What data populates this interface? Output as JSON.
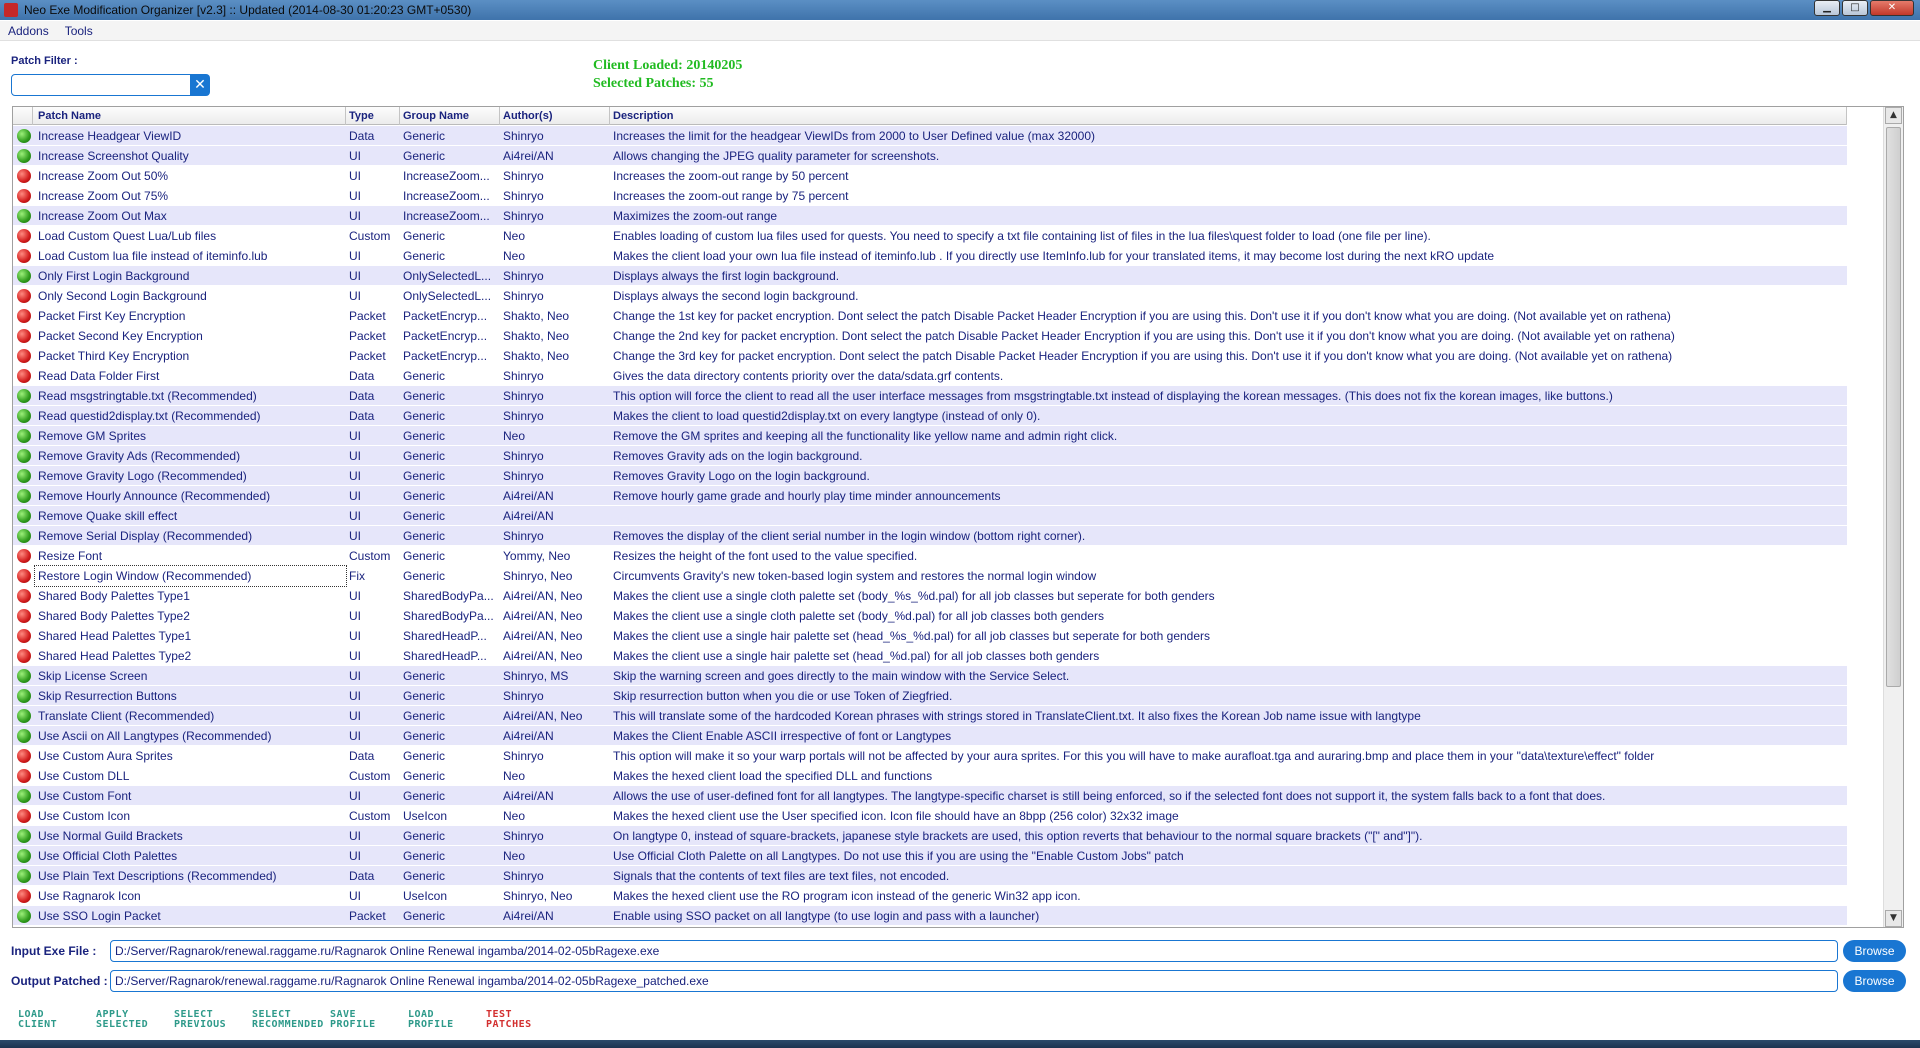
{
  "window": {
    "title": "Neo Exe Modification Organizer [v2.3]    ::   Updated (2014-08-30  01:20:23  GMT+0530)",
    "min": "▁",
    "max": "□",
    "close": "✕"
  },
  "menu": [
    "Addons",
    "Tools"
  ],
  "filter": {
    "label": "Patch Filter :",
    "value": "",
    "clear": "✕"
  },
  "client": {
    "loaded": "Client Loaded: 20140205",
    "selected": "Selected Patches: 55"
  },
  "table": {
    "columns": [
      "Patch Name",
      "Type",
      "Group Name",
      "Author(s)",
      "Description"
    ],
    "rows": [
      {
        "on": true,
        "sel": true,
        "name": "Increase Headgear ViewID",
        "type": "Data",
        "group": "Generic",
        "author": "Shinryo",
        "desc": "Increases the limit for the headgear ViewIDs from 2000 to User Defined value (max 32000)"
      },
      {
        "on": true,
        "sel": true,
        "name": "Increase Screenshot Quality",
        "type": "UI",
        "group": "Generic",
        "author": "Ai4rei/AN",
        "desc": "Allows changing the JPEG quality parameter for screenshots."
      },
      {
        "on": false,
        "sel": false,
        "name": "Increase Zoom Out 50%",
        "type": "UI",
        "group": "IncreaseZoom...",
        "author": "Shinryo",
        "desc": "Increases the zoom-out range by 50 percent"
      },
      {
        "on": false,
        "sel": false,
        "name": "Increase Zoom Out 75%",
        "type": "UI",
        "group": "IncreaseZoom...",
        "author": "Shinryo",
        "desc": "Increases the zoom-out range by 75 percent"
      },
      {
        "on": true,
        "sel": true,
        "name": "Increase Zoom Out Max",
        "type": "UI",
        "group": "IncreaseZoom...",
        "author": "Shinryo",
        "desc": "Maximizes the zoom-out range"
      },
      {
        "on": false,
        "sel": false,
        "name": "Load Custom Quest Lua/Lub files",
        "type": "Custom",
        "group": "Generic",
        "author": "Neo",
        "desc": "Enables loading of custom lua files used for quests. You need to specify a txt file containing list of files in the lua files\\quest folder to load (one file per line)."
      },
      {
        "on": false,
        "sel": false,
        "name": "Load Custom lua file instead of iteminfo.lub",
        "type": "UI",
        "group": "Generic",
        "author": "Neo",
        "desc": "Makes the client load your own lua file instead of iteminfo.lub . If you directly use ItemInfo.lub for your translated items, it may become lost during the next kRO update"
      },
      {
        "on": true,
        "sel": true,
        "name": "Only First Login Background",
        "type": "UI",
        "group": "OnlySelectedL...",
        "author": "Shinryo",
        "desc": "Displays always the first login background."
      },
      {
        "on": false,
        "sel": false,
        "name": "Only Second Login Background",
        "type": "UI",
        "group": "OnlySelectedL...",
        "author": "Shinryo",
        "desc": "Displays always the second login background."
      },
      {
        "on": false,
        "sel": false,
        "name": "Packet First Key Encryption",
        "type": "Packet",
        "group": "PacketEncryp...",
        "author": "Shakto, Neo",
        "desc": "Change the 1st key for packet encryption. Dont select the patch Disable Packet Header Encryption if you are using this. Don't use it if you don't know what you are doing. (Not available yet on rathena)"
      },
      {
        "on": false,
        "sel": false,
        "name": "Packet Second Key Encryption",
        "type": "Packet",
        "group": "PacketEncryp...",
        "author": "Shakto, Neo",
        "desc": "Change the 2nd key for packet encryption. Dont select the patch Disable Packet Header Encryption if you are using this. Don't use it if you don't know what you are doing. (Not available yet on rathena)"
      },
      {
        "on": false,
        "sel": false,
        "name": "Packet Third Key Encryption",
        "type": "Packet",
        "group": "PacketEncryp...",
        "author": "Shakto, Neo",
        "desc": "Change the 3rd key for packet encryption. Dont select the patch Disable Packet Header Encryption if you are using this. Don't use it if you don't know what you are doing. (Not available yet on rathena)"
      },
      {
        "on": false,
        "sel": false,
        "name": "Read Data Folder First",
        "type": "Data",
        "group": "Generic",
        "author": "Shinryo",
        "desc": "Gives the data directory contents priority over the data/sdata.grf contents."
      },
      {
        "on": true,
        "sel": true,
        "name": "Read msgstringtable.txt (Recommended)",
        "type": "Data",
        "group": "Generic",
        "author": "Shinryo",
        "desc": "This option will force the client to read all the user interface messages from  msgstringtable.txt instead of displaying the korean messages.  (This does not fix the korean images, like buttons.)"
      },
      {
        "on": true,
        "sel": true,
        "name": "Read questid2display.txt (Recommended)",
        "type": "Data",
        "group": "Generic",
        "author": "Shinryo",
        "desc": "Makes the client to load questid2display.txt on every langtype (instead of only 0)."
      },
      {
        "on": true,
        "sel": true,
        "name": "Remove GM Sprites",
        "type": "UI",
        "group": "Generic",
        "author": "Neo",
        "desc": "Remove the GM sprites and keeping all the functionality like yellow name and admin right click."
      },
      {
        "on": true,
        "sel": true,
        "name": "Remove Gravity Ads (Recommended)",
        "type": "UI",
        "group": "Generic",
        "author": "Shinryo",
        "desc": "Removes Gravity ads on the login background."
      },
      {
        "on": true,
        "sel": true,
        "name": "Remove Gravity Logo (Recommended)",
        "type": "UI",
        "group": "Generic",
        "author": "Shinryo",
        "desc": "Removes Gravity Logo on the login background."
      },
      {
        "on": true,
        "sel": true,
        "name": "Remove Hourly Announce (Recommended)",
        "type": "UI",
        "group": "Generic",
        "author": "Ai4rei/AN",
        "desc": "Remove hourly game grade and hourly play time minder announcements"
      },
      {
        "on": true,
        "sel": true,
        "name": "Remove Quake skill effect",
        "type": "UI",
        "group": "Generic",
        "author": "Ai4rei/AN",
        "desc": ""
      },
      {
        "on": true,
        "sel": true,
        "name": "Remove Serial Display (Recommended)",
        "type": "UI",
        "group": "Generic",
        "author": "Shinryo",
        "desc": "Removes the display of the client serial number in the login window (bottom right corner)."
      },
      {
        "on": false,
        "sel": false,
        "name": "Resize Font",
        "type": "Custom",
        "group": "Generic",
        "author": "Yommy, Neo",
        "desc": "Resizes the height of the font used to the value specified."
      },
      {
        "on": false,
        "sel": false,
        "name": "Restore Login Window (Recommended)",
        "type": "Fix",
        "group": "Generic",
        "author": "Shinryo, Neo",
        "desc": "Circumvents Gravity's new token-based login system and restores the normal login window",
        "focus": true
      },
      {
        "on": false,
        "sel": false,
        "name": "Shared Body Palettes Type1",
        "type": "UI",
        "group": "SharedBodyPa...",
        "author": "Ai4rei/AN, Neo",
        "desc": "Makes the client use a single cloth palette set (body_%s_%d.pal) for all job classes but seperate for both genders"
      },
      {
        "on": false,
        "sel": false,
        "name": "Shared Body Palettes Type2",
        "type": "UI",
        "group": "SharedBodyPa...",
        "author": "Ai4rei/AN, Neo",
        "desc": "Makes the client use a single cloth palette set (body_%d.pal) for all job classes both genders"
      },
      {
        "on": false,
        "sel": false,
        "name": "Shared Head Palettes Type1",
        "type": "UI",
        "group": "SharedHeadP...",
        "author": "Ai4rei/AN, Neo",
        "desc": "Makes the client use a single hair palette set (head_%s_%d.pal) for all job classes but seperate for both genders"
      },
      {
        "on": false,
        "sel": false,
        "name": "Shared Head Palettes Type2",
        "type": "UI",
        "group": "SharedHeadP...",
        "author": "Ai4rei/AN, Neo",
        "desc": "Makes the client use a single hair palette set (head_%d.pal) for all job classes both genders"
      },
      {
        "on": true,
        "sel": true,
        "name": "Skip License Screen",
        "type": "UI",
        "group": "Generic",
        "author": "Shinryo, MS",
        "desc": "Skip the warning screen and goes directly to the main window with the Service Select."
      },
      {
        "on": true,
        "sel": true,
        "name": "Skip Resurrection Buttons",
        "type": "UI",
        "group": "Generic",
        "author": "Shinryo",
        "desc": "Skip resurrection button when you die or use Token of Ziegfried."
      },
      {
        "on": true,
        "sel": true,
        "name": "Translate Client (Recommended)",
        "type": "UI",
        "group": "Generic",
        "author": "Ai4rei/AN, Neo",
        "desc": "This will translate some of the hardcoded Korean phrases with strings stored in TranslateClient.txt. It also fixes the Korean Job name issue with langtype"
      },
      {
        "on": true,
        "sel": true,
        "name": "Use Ascii on All Langtypes (Recommended)",
        "type": "UI",
        "group": "Generic",
        "author": "Ai4rei/AN",
        "desc": "Makes the Client Enable ASCII irrespective of font or Langtypes"
      },
      {
        "on": false,
        "sel": false,
        "name": "Use Custom Aura Sprites",
        "type": "Data",
        "group": "Generic",
        "author": "Shinryo",
        "desc": "This option will make it so your warp portals will not be affected by your aura sprites. For this you will have to make aurafloat.tga and auraring.bmp and place them in your \"data\\texture\\effect\" folder"
      },
      {
        "on": false,
        "sel": false,
        "name": "Use Custom DLL",
        "type": "Custom",
        "group": "Generic",
        "author": "Neo",
        "desc": "Makes the hexed client load the specified DLL and functions"
      },
      {
        "on": true,
        "sel": true,
        "name": "Use Custom Font",
        "type": "UI",
        "group": "Generic",
        "author": "Ai4rei/AN",
        "desc": "Allows the use of user-defined font for all langtypes. The langtype-specific charset is still being enforced, so if the selected font does not support it, the system falls back to a font that does."
      },
      {
        "on": false,
        "sel": false,
        "name": "Use Custom Icon",
        "type": "Custom",
        "group": "UseIcon",
        "author": "Neo",
        "desc": "Makes the hexed client use the User specified icon. Icon file should have an 8bpp (256 color) 32x32 image"
      },
      {
        "on": true,
        "sel": true,
        "name": "Use Normal Guild Brackets",
        "type": "UI",
        "group": "Generic",
        "author": "Shinryo",
        "desc": "On langtype 0, instead of square-brackets, japanese style brackets are used, this option reverts that behaviour to the normal square brackets (\"[\" and\"]\")."
      },
      {
        "on": true,
        "sel": true,
        "name": "Use Official Cloth Palettes",
        "type": "UI",
        "group": "Generic",
        "author": "Neo",
        "desc": "Use Official Cloth Palette on all Langtypes. Do not use this if you are using the \"Enable Custom Jobs\" patch"
      },
      {
        "on": true,
        "sel": true,
        "name": "Use Plain Text Descriptions (Recommended)",
        "type": "Data",
        "group": "Generic",
        "author": "Shinryo",
        "desc": "Signals that the contents of text files are text files, not encoded."
      },
      {
        "on": false,
        "sel": false,
        "name": "Use Ragnarok Icon",
        "type": "UI",
        "group": "UseIcon",
        "author": "Shinryo, Neo",
        "desc": "Makes the hexed client use the RO program icon instead of the generic Win32 app icon."
      },
      {
        "on": true,
        "sel": true,
        "name": "Use SSO Login Packet",
        "type": "Packet",
        "group": "Generic",
        "author": "Ai4rei/AN",
        "desc": "Enable using SSO packet on all langtype (to use login and pass with a launcher)"
      }
    ]
  },
  "files": {
    "input_label": "Input Exe File :",
    "input_value": "D:/Server/Ragnarok/renewal.raggame.ru/Ragnarok Online Renewal ingamba/2014-02-05bRagexe.exe",
    "output_label": "Output Patched :",
    "output_value": "D:/Server/Ragnarok/renewal.raggame.ru/Ragnarok Online Renewal ingamba/2014-02-05bRagexe_patched.exe",
    "browse": "Browse"
  },
  "actions": [
    {
      "l1": "LOAD",
      "l2": "CLIENT"
    },
    {
      "l1": "APPLY",
      "l2": "SELECTED"
    },
    {
      "l1": "SELECT",
      "l2": "PREVIOUS"
    },
    {
      "l1": "SELECT",
      "l2": "RECOMMENDED"
    },
    {
      "l1": "SAVE",
      "l2": "PROFILE"
    },
    {
      "l1": "LOAD",
      "l2": "PROFILE"
    },
    {
      "l1": "TEST",
      "l2": "PATCHES"
    }
  ],
  "colors": {
    "accent": "#1976d2",
    "text": "#1a237e",
    "client_info": "#22bb22",
    "enabled": "#2e9a1b",
    "disabled": "#d11b1b",
    "selected_row": "#e6e6fa"
  }
}
